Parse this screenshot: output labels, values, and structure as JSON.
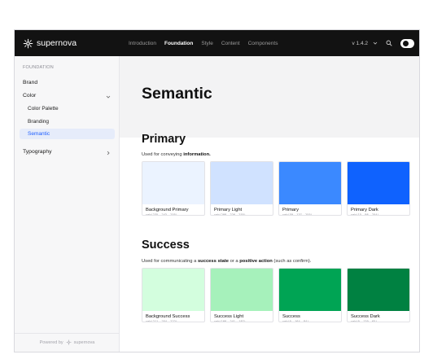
{
  "brand": {
    "name": "supernova"
  },
  "topnav": {
    "items": [
      "Introduction",
      "Foundation",
      "Style",
      "Content",
      "Components"
    ],
    "active": "Foundation",
    "version": "v 1.4.2"
  },
  "sidebar": {
    "section": "FOUNDATION",
    "brand_label": "Brand",
    "color_label": "Color",
    "sub_items": [
      "Color Palette",
      "Branding",
      "Semantic"
    ],
    "typography_label": "Typography",
    "powered_by": "Powered by",
    "powered_brand": "supernova"
  },
  "page": {
    "title": "Semantic"
  },
  "primary": {
    "title": "Primary",
    "desc_prefix": "Used for conveying ",
    "desc_bold": "information.",
    "swatches": [
      {
        "name": "Background Primary",
        "rgb": "rgb(235, 243, 255)",
        "color": "#ebf3ff"
      },
      {
        "name": "Primary Light",
        "rgb": "rgb(208, 226, 255)",
        "color": "#d0e2ff"
      },
      {
        "name": "Primary",
        "rgb": "rgb(59, 137, 255)",
        "color": "#3b89ff"
      },
      {
        "name": "Primary Dark",
        "rgb": "rgb(15, 98, 254)",
        "color": "#0f62fe"
      }
    ]
  },
  "success": {
    "title": "Success",
    "desc_1": "Used for communicating a ",
    "desc_bold_1": "success state",
    "desc_2": " or a ",
    "desc_bold_2": "positive action",
    "desc_3": " (such as confirm).",
    "swatches": [
      {
        "name": "Background Success",
        "rgb": "rgb(211, 254, 222)",
        "color": "#d3fede"
      },
      {
        "name": "Success Light",
        "rgb": "rgb(166, 241, 187)",
        "color": "#a6f1bb"
      },
      {
        "name": "Success",
        "rgb": "rgb(0, 164, 84)",
        "color": "#00a454"
      },
      {
        "name": "Success Dark",
        "rgb": "rgb(0, 129, 65)",
        "color": "#008141"
      }
    ]
  }
}
